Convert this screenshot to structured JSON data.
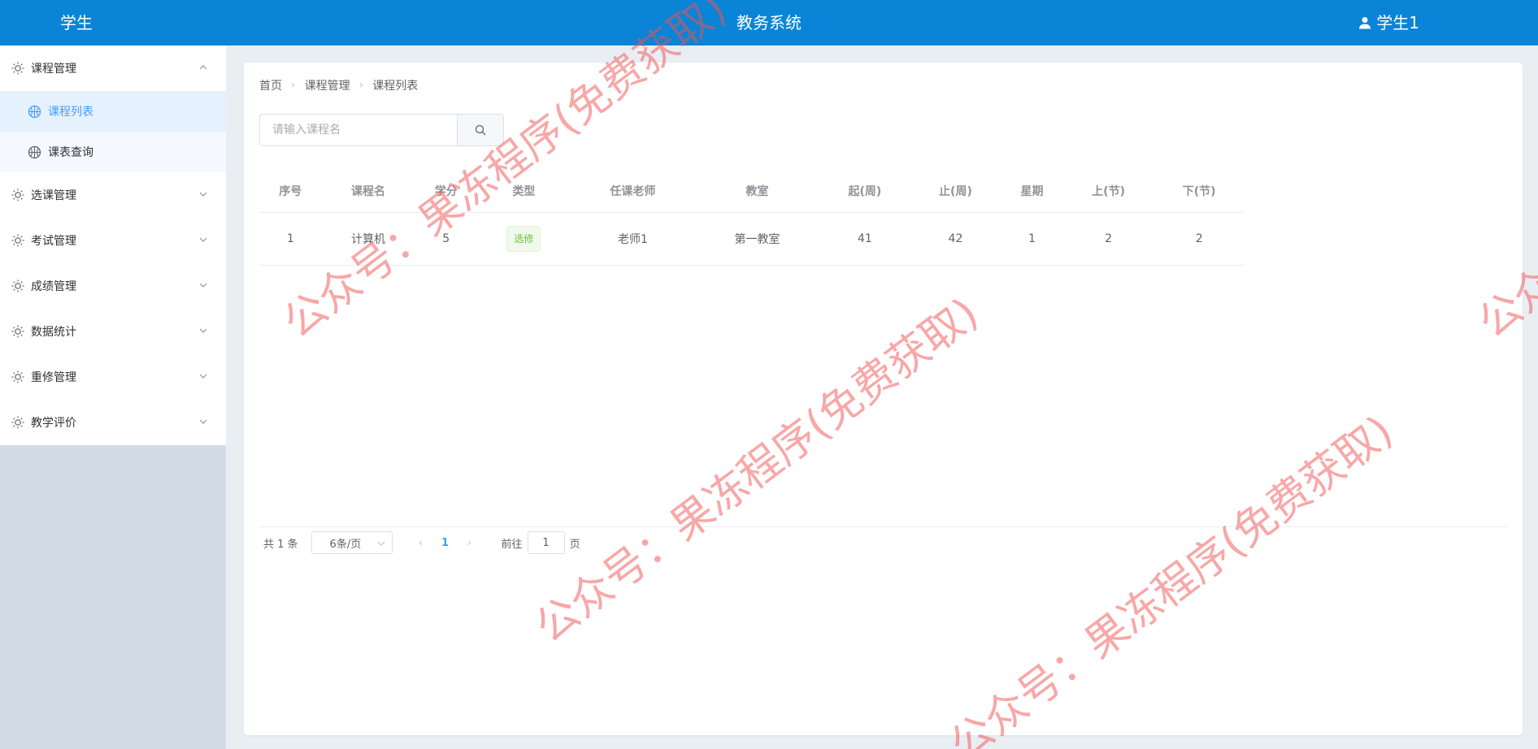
{
  "header": {
    "role": "学生",
    "title": "教务系统",
    "user": "学生1"
  },
  "sidebar": {
    "menus": [
      {
        "label": "课程管理",
        "expanded": true,
        "children": [
          {
            "label": "课程列表",
            "active": true
          },
          {
            "label": "课表查询",
            "active": false
          }
        ]
      },
      {
        "label": "选课管理",
        "expanded": false
      },
      {
        "label": "考试管理",
        "expanded": false
      },
      {
        "label": "成绩管理",
        "expanded": false
      },
      {
        "label": "数据统计",
        "expanded": false
      },
      {
        "label": "重修管理",
        "expanded": false
      },
      {
        "label": "教学评价",
        "expanded": false
      }
    ]
  },
  "breadcrumb": [
    "首页",
    "课程管理",
    "课程列表"
  ],
  "search": {
    "placeholder": "请输入课程名",
    "value": ""
  },
  "table": {
    "columns": [
      "序号",
      "课程名",
      "学分",
      "类型",
      "任课老师",
      "教室",
      "起(周)",
      "止(周)",
      "星期",
      "上(节)",
      "下(节)"
    ],
    "rows": [
      {
        "index": "1",
        "name": "计算机",
        "credit": "5",
        "type": "选修",
        "teacher": "老师1",
        "room": "第一教室",
        "start_week": "41",
        "end_week": "42",
        "weekday": "1",
        "start_period": "2",
        "end_period": "2"
      }
    ]
  },
  "pagination": {
    "total_text": "共 1 条",
    "page_size": "6条/页",
    "current_page": "1",
    "goto_label": "前往",
    "goto_value": "1",
    "page_suffix": "页"
  },
  "watermark": {
    "text": "公众号：果冻程序(免费获取)"
  },
  "colors": {
    "header": "#0a84d6",
    "accent": "#409eff",
    "tag_green": "#67c23a"
  }
}
